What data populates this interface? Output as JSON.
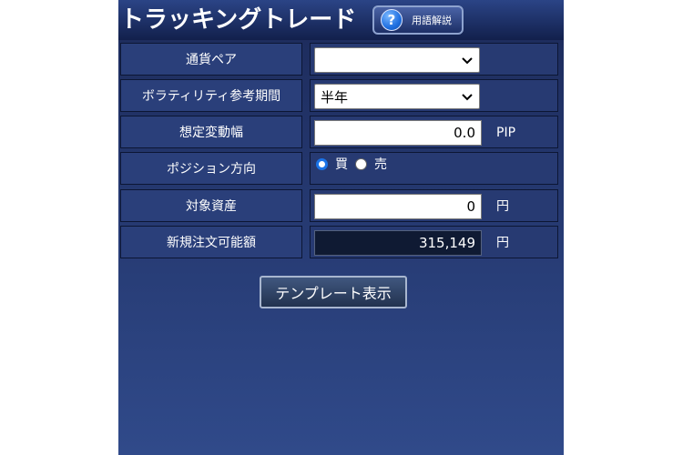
{
  "header": {
    "title": "トラッキングトレード",
    "help_label": "用語解説",
    "help_icon": "question-icon"
  },
  "form": {
    "currency_pair": {
      "label": "通貨ペア",
      "selected": ""
    },
    "volatility_period": {
      "label": "ボラティリティ参考期間",
      "selected": "半年"
    },
    "expected_range": {
      "label": "想定変動幅",
      "value": "0.0",
      "unit": "PIP"
    },
    "position_direction": {
      "label": "ポジション方向",
      "options": [
        "買",
        "売"
      ],
      "selected": "買"
    },
    "target_assets": {
      "label": "対象資産",
      "value": "0",
      "unit": "円"
    },
    "available_order": {
      "label": "新規注文可能額",
      "value": "315,149",
      "unit": "円"
    }
  },
  "actions": {
    "template_label": "テンプレート表示"
  },
  "colors": {
    "panel": "#24376e",
    "accent": "#1a73e8"
  }
}
